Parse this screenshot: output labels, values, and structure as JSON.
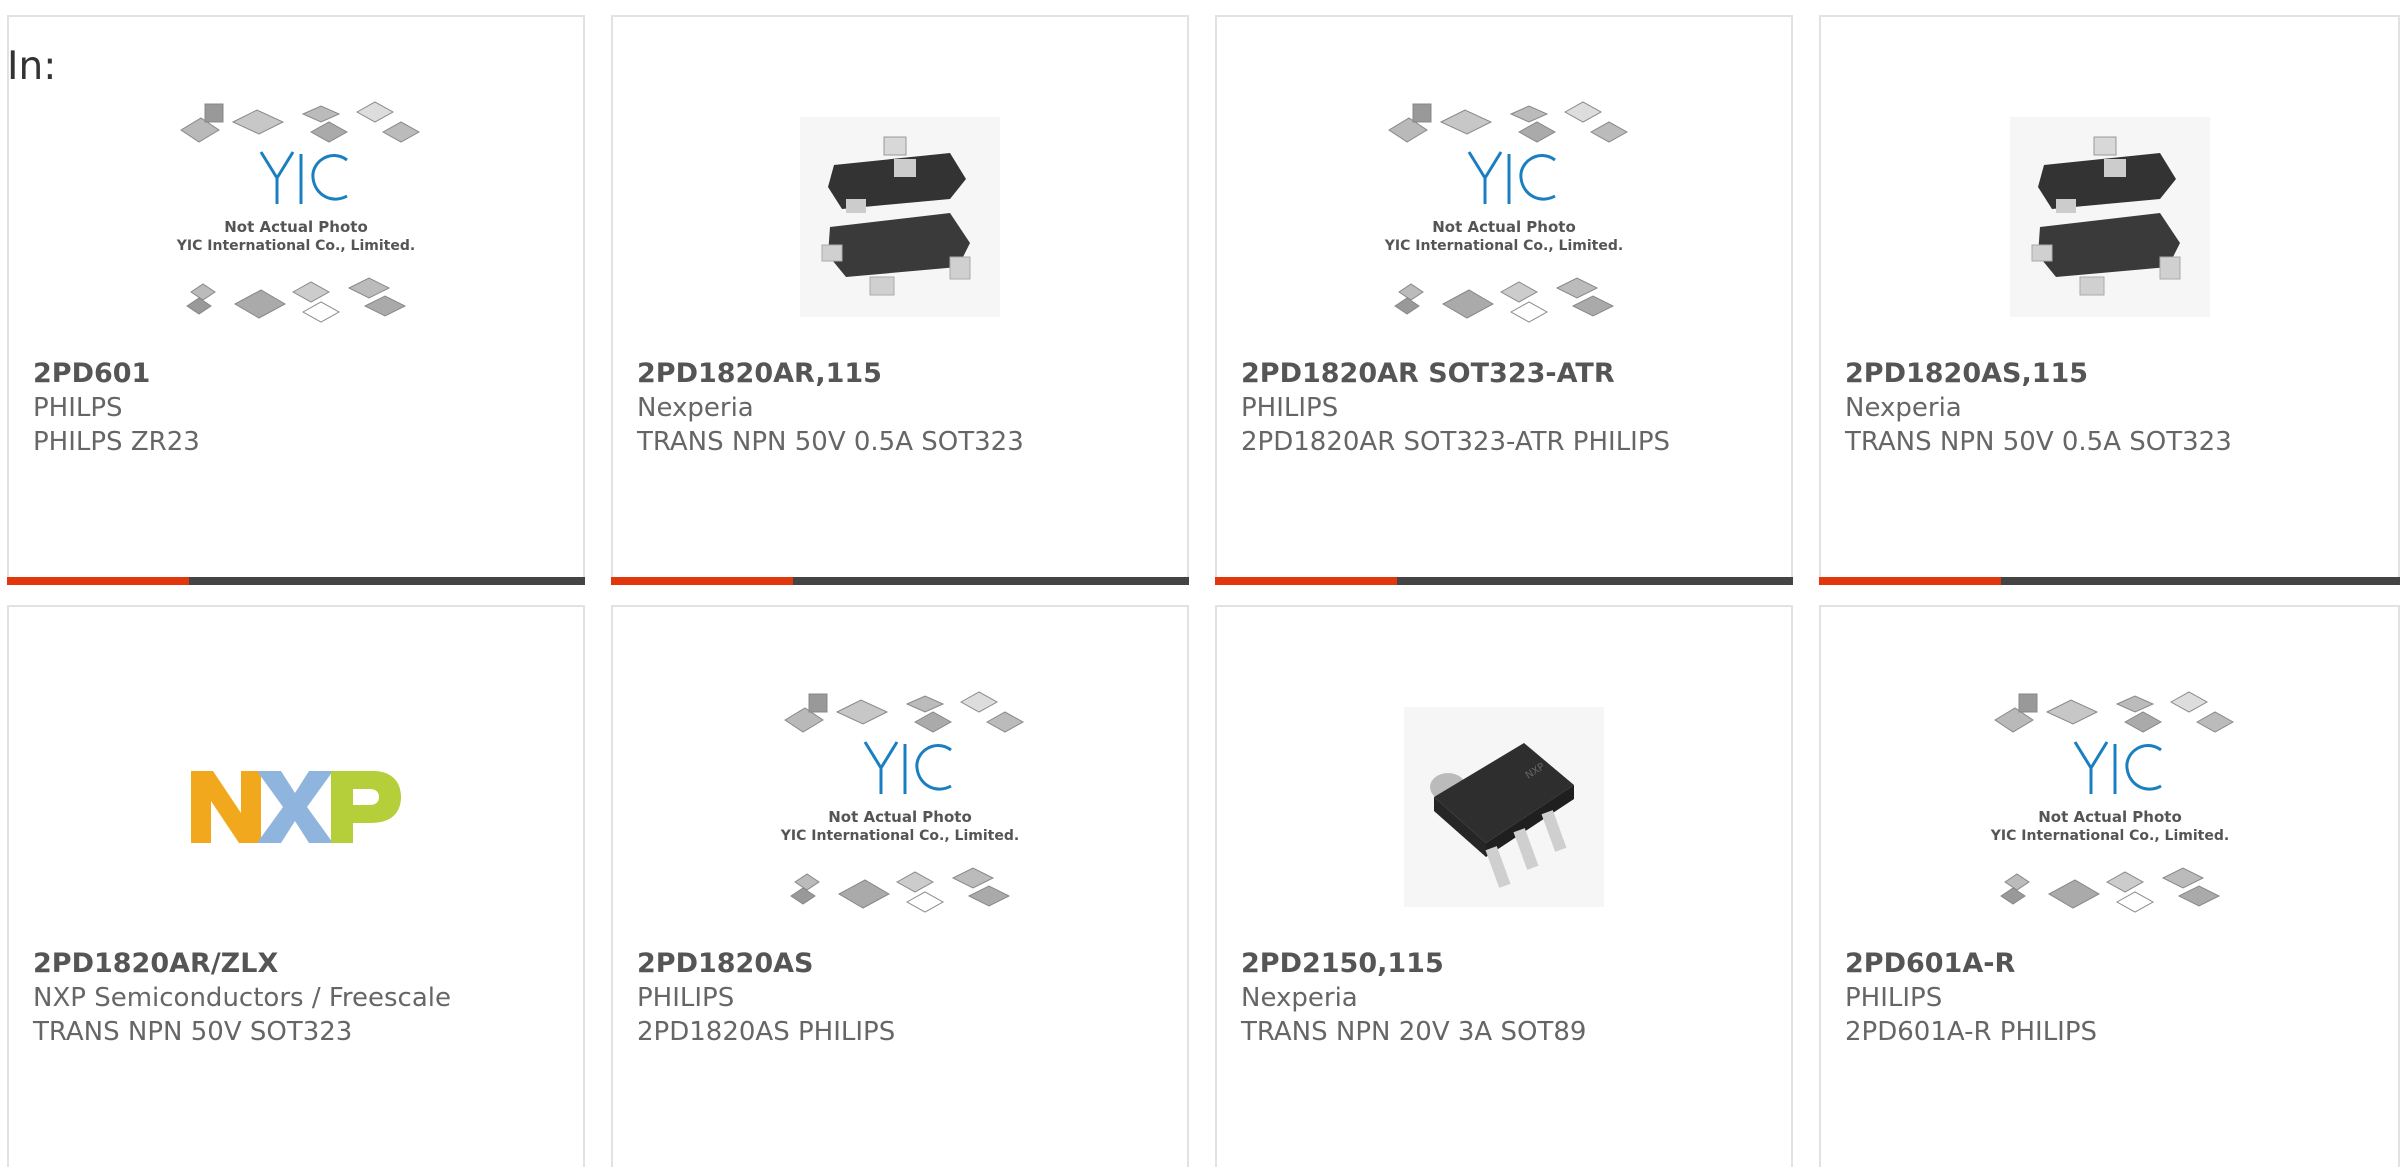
{
  "header": {
    "label": "In:"
  },
  "products": [
    {
      "part_number": "2PD601",
      "manufacturer": "PHILPS",
      "description": "PHILPS ZR23",
      "image": "placeholder",
      "image_text": {
        "line1": "Not Actual Photo",
        "line2": "YIC International Co., Limited."
      }
    },
    {
      "part_number": "2PD1820AR,115",
      "manufacturer": "Nexperia",
      "description": "TRANS NPN 50V 0.5A SOT323",
      "image": "sot323"
    },
    {
      "part_number": "2PD1820AR SOT323-ATR",
      "manufacturer": "PHILIPS",
      "description": "2PD1820AR SOT323-ATR PHILIPS",
      "image": "placeholder",
      "image_text": {
        "line1": "Not Actual Photo",
        "line2": "YIC International Co., Limited."
      }
    },
    {
      "part_number": "2PD1820AS,115",
      "manufacturer": "Nexperia",
      "description": "TRANS NPN 50V 0.5A SOT323",
      "image": "sot323"
    },
    {
      "part_number": "2PD1820AR/ZLX",
      "manufacturer": "NXP Semiconductors / Freescale",
      "description": "TRANS NPN 50V SOT323",
      "image": "nxp-logo"
    },
    {
      "part_number": "2PD1820AS",
      "manufacturer": "PHILIPS",
      "description": "2PD1820AS PHILIPS",
      "image": "placeholder",
      "image_text": {
        "line1": "Not Actual Photo",
        "line2": "YIC International Co., Limited."
      }
    },
    {
      "part_number": "2PD2150,115",
      "manufacturer": "Nexperia",
      "description": "TRANS NPN 20V 3A SOT89",
      "image": "sot89"
    },
    {
      "part_number": "2PD601A-R",
      "manufacturer": "PHILIPS",
      "description": "2PD601A-R PHILIPS",
      "image": "placeholder",
      "image_text": {
        "line1": "Not Actual Photo",
        "line2": "YIC International Co., Limited."
      }
    }
  ],
  "colors": {
    "accent": "#e2360d",
    "bar": "#444444",
    "border": "#e2e2e2",
    "yic_blue": "#1a7fc1"
  }
}
